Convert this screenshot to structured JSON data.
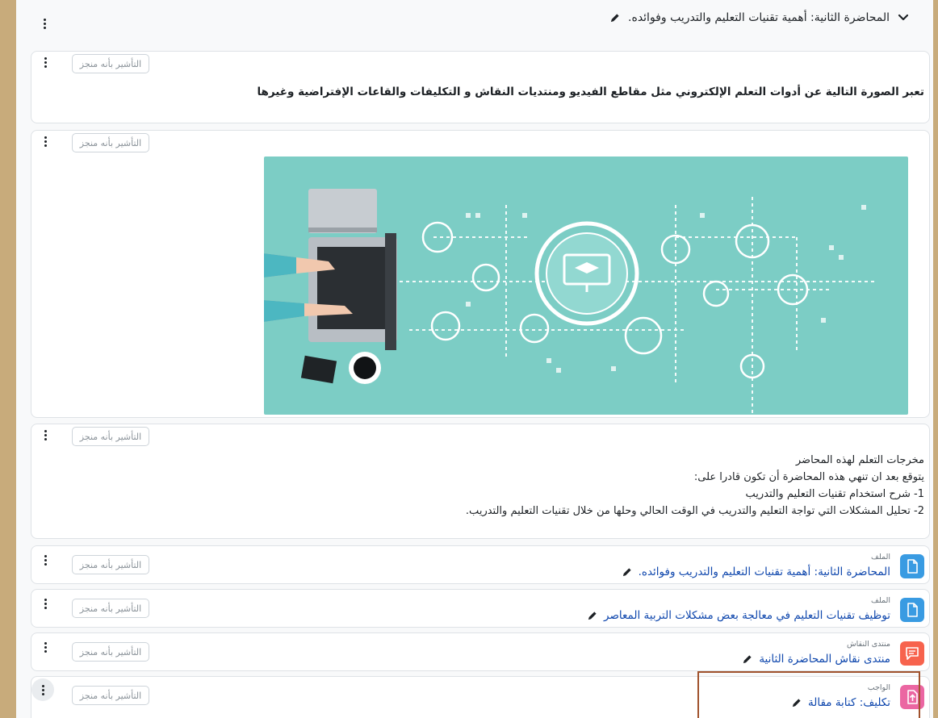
{
  "section": {
    "title": "المحاضرة الثانية: أهمية تقنيات التعليم والتدريب وفوائده.",
    "collapse_icon": "chevron-down-icon",
    "edit_icon": "pencil-icon"
  },
  "mark_done_label": "التأشير بأنه منجز",
  "text_block": {
    "description": "تعبر الصورة التالية عن أدوات التعلم الإلكتروني مثل مقاطع الفيديو ومنتديات النقاش و التكليفات والقاعات الإفتراضية وغيرها"
  },
  "outcomes": {
    "lines": [
      "مخرجات التعلم لهذه المحاضر",
      "يتوقع بعد ان تنهي هذه المحاضرة أن تكون قادرا على:",
      "1-  شرح استخدام تقنيات التعليم والتدريب",
      "2- تحليل المشكلات التي تواجة التعليم والتدريب في الوقت الحالي وحلها من خلال تقنيات التعليم والتدريب."
    ]
  },
  "activities": [
    {
      "type": "الملف",
      "name": "المحاضرة الثانية: أهمية تقنيات التعليم والتدريب وفوائده.",
      "icon": "file-icon",
      "color": "#399be2"
    },
    {
      "type": "الملف",
      "name": "توظيف تقنيات التعليم في معالجة بعض مشكلات التربية المعاصر",
      "icon": "file-icon",
      "color": "#399be2"
    },
    {
      "type": "منتدى النقاش",
      "name": "منتدى نقاش المحاضرة الثانية",
      "icon": "forum-icon",
      "color": "#f7634d"
    },
    {
      "type": "الواجب",
      "name": "تكليف: كتابة مقالة",
      "icon": "assignment-upload-icon",
      "color": "#eb66a2"
    }
  ],
  "colors": {
    "frame": "#c8ab7b",
    "link": "#0f47ad",
    "banner_bg": "#7ccdc5",
    "highlight_border": "#a0522d"
  }
}
